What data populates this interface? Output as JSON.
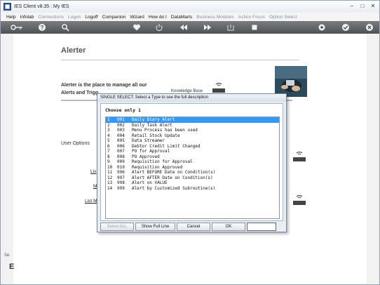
{
  "window": {
    "title": "IES Client v8.35 : My IES"
  },
  "menu": {
    "items": [
      {
        "label": "Help",
        "enabled": true
      },
      {
        "label": "Infolab",
        "enabled": true
      },
      {
        "label": "Connections",
        "enabled": false
      },
      {
        "label": "Logon",
        "enabled": false
      },
      {
        "label": "Logoff",
        "enabled": true
      },
      {
        "label": "Companion",
        "enabled": true
      },
      {
        "label": "Wizard",
        "enabled": true
      },
      {
        "label": "How do I",
        "enabled": true
      },
      {
        "label": "DataMarts",
        "enabled": true
      },
      {
        "label": "Business Modules",
        "enabled": false
      },
      {
        "label": "Action Focus",
        "enabled": false
      },
      {
        "label": "Option Select",
        "enabled": false
      }
    ]
  },
  "toolbar": {
    "icons": [
      "key-icon",
      "help-icon",
      "search-icon",
      "heart-icon",
      "power-icon",
      "rewind-icon",
      "fast-forward-icon",
      "tray-icon",
      "stop-icon",
      "settings-icon",
      "check-icon",
      "close-icon"
    ]
  },
  "page": {
    "title": "Alerter",
    "intro_line1": "Alerter is the place to manage all our",
    "intro_line2": "Alerts and Trigg",
    "kb_label": "Knowledge Base",
    "user_options": "User Options",
    "link_a": "Lis",
    "link_b": "M",
    "link_c": "List M",
    "left_frag_top": "Se",
    "left_frag_bottom": "E"
  },
  "dialog": {
    "title": "SINGLE SELECT: Select a Type to see the full description",
    "heading": "Choose only 1",
    "items": [
      {
        "n": "1",
        "code": "001",
        "desc": "Daily Diary Alert",
        "selected": true
      },
      {
        "n": "2",
        "code": "002",
        "desc": "Daily Task Alert",
        "selected": false
      },
      {
        "n": "3",
        "code": "003",
        "desc": "Menu Process has been used",
        "selected": false
      },
      {
        "n": "4",
        "code": "004",
        "desc": "Retail Stock Update",
        "selected": false
      },
      {
        "n": "5",
        "code": "005",
        "desc": "Data Streamer",
        "selected": false
      },
      {
        "n": "6",
        "code": "006",
        "desc": "Debtor Credit Limit Changed",
        "selected": false
      },
      {
        "n": "7",
        "code": "007",
        "desc": "PO for Approval",
        "selected": false
      },
      {
        "n": "8",
        "code": "008",
        "desc": "PO Approved",
        "selected": false
      },
      {
        "n": "9",
        "code": "009",
        "desc": "Requisition for Approval",
        "selected": false
      },
      {
        "n": "10",
        "code": "010",
        "desc": "Requisition Approved",
        "selected": false
      },
      {
        "n": "11",
        "code": "996",
        "desc": "Alert BEFORE Date on Condition(s)",
        "selected": false
      },
      {
        "n": "12",
        "code": "997",
        "desc": "Alert AFTER Date on Condition(s)",
        "selected": false
      },
      {
        "n": "13",
        "code": "998",
        "desc": "Alert on VALUE",
        "selected": false
      },
      {
        "n": "14",
        "code": "999",
        "desc": "Alert by Customized Subroutine(s)",
        "selected": false
      }
    ],
    "buttons": {
      "select_all": "Select ALL",
      "show_full_line": "Show Full Line",
      "cancel": "Cancel",
      "ok": "OK"
    },
    "input_value": ""
  },
  "colors": {
    "selection": "#3399ff",
    "toolbar": "#5f6265",
    "dialog_bg": "#e8eef5"
  }
}
